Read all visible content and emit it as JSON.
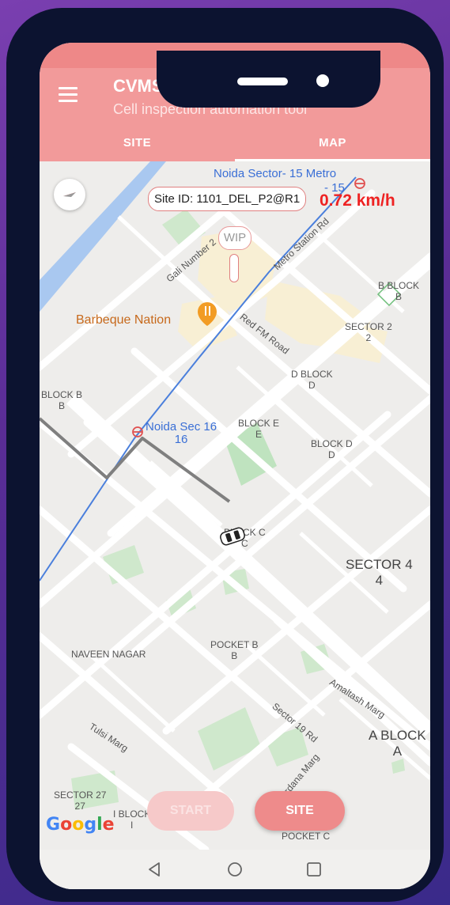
{
  "app": {
    "title": "CVMS",
    "subtitle": "Cell inspection automation tool"
  },
  "tabs": [
    {
      "label": "SITE",
      "active": false
    },
    {
      "label": "MAP",
      "active": true
    }
  ],
  "overlay": {
    "site_id": "Site ID: 1101_DEL_P2@R1",
    "speed": "0.72 km/h",
    "wip_label": "WIP"
  },
  "map": {
    "labels": {
      "noida_sector15": "Noida Sector- 15 Metro",
      "noida_sector15_line2": "- 15",
      "metro_station_rd": "Metro Station Rd",
      "gali_number2": "Gali Number 2",
      "b_block_right": "B BLOCK\nB",
      "barbeque_nation": "Barbeque Nation",
      "sector2": "SECTOR 2\n2",
      "red_fm_road": "Red FM Road",
      "d_block": "D BLOCK\nD",
      "block_b_left": "BLOCK B\nB",
      "noida_sec16": "Noida Sec 16\n16",
      "block_e": "BLOCK E\nE",
      "block_d": "BLOCK D\nD",
      "block_c": "BLOCK C\nC",
      "sector4": "SECTOR 4\n4",
      "naveen_nagar": "NAVEEN NAGAR",
      "pocket_b": "POCKET B\nB",
      "amaltash_marg": "Amaltash Marg",
      "sector19_rd": "Sector 19 Rd",
      "tulsi_marg": "Tulsi Marg",
      "arjun_sardana_marg": "Arjun Sardana Marg",
      "a_block": "A BLOCK\nA",
      "sector27": "SECTOR 27\n27",
      "i_block": "I BLOCK\nI",
      "pocket_c": "POCKET C"
    },
    "attribution": "Google"
  },
  "buttons": {
    "start": "START",
    "site": "SITE"
  },
  "colors": {
    "appbar": "#f29a9a",
    "accent": "#ee8b8b",
    "speed": "#ee2222",
    "metro_line": "#4a7fdc"
  },
  "icons": [
    "menu-icon",
    "compass-icon",
    "metro-icon",
    "restaurant-icon",
    "car-icon",
    "back-icon",
    "home-icon",
    "recents-icon"
  ]
}
